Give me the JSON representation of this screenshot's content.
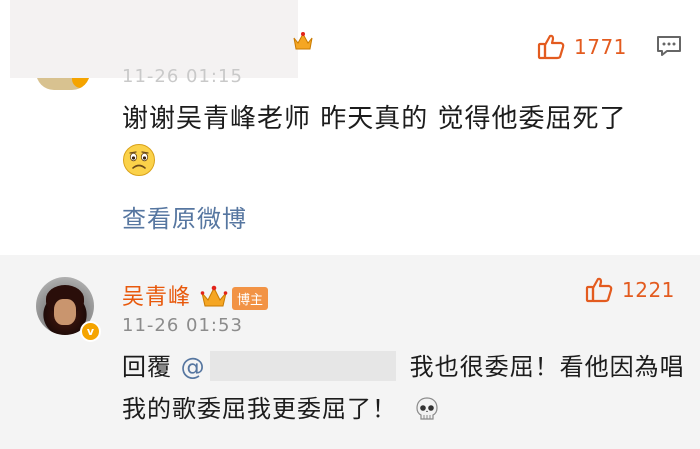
{
  "top_comment": {
    "time_faded": "11-26 01:15",
    "like_count": "1771",
    "text": "谢谢吴青峰老师 昨天真的 觉得他委屈死了",
    "view_original": "查看原微博",
    "icons": [
      "crown-icon",
      "thumb-up-icon",
      "comment-icon",
      "sad-face-emoji",
      "v-badge"
    ]
  },
  "reply": {
    "username": "吴青峰",
    "badge": "博主",
    "time": "11-26 01:53",
    "like_count": "1221",
    "prefix": "回覆",
    "mention": "@",
    "line1_rest": "我也很委屈！看他因為唱",
    "line2": "我的歌委屈我更委屈了！",
    "icons": [
      "avatar",
      "v-badge-icon",
      "crown-icon",
      "thumb-up-icon",
      "skull-emoji"
    ]
  },
  "colors": {
    "accent": "#e35b1f",
    "username": "#e8590c",
    "link": "#5676a0",
    "reply_bg": "#f4f4f4",
    "badge_bg": "#f29345"
  }
}
